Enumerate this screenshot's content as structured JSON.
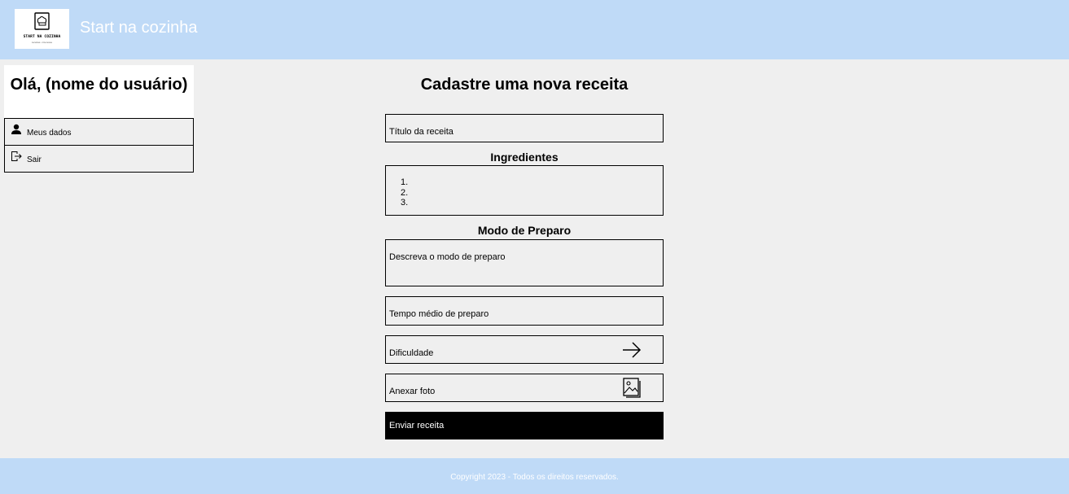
{
  "header": {
    "logo_text": "START NA COZINHA",
    "logo_subtext": "receitas • interesse",
    "app_title": "Start na cozinha"
  },
  "sidebar": {
    "greeting": "Olá, (nome do usuário)",
    "items": [
      {
        "label": "Meus dados",
        "icon": "user-icon"
      },
      {
        "label": "Sair",
        "icon": "logout-icon"
      }
    ]
  },
  "form": {
    "title": "Cadastre uma nova receita",
    "recipe_title_placeholder": "Título da receita",
    "ingredients_label": "Ingredientes",
    "ingredients_list": [
      "1.",
      "2.",
      "3."
    ],
    "method_label": "Modo de Preparo",
    "method_placeholder": "Descreva o modo de preparo",
    "time_placeholder": "Tempo médio de preparo",
    "difficulty_label": "Dificuldade",
    "difficulty_icon": "arrow-right-icon",
    "photo_label": "Anexar foto",
    "photo_icon": "image-icon",
    "submit_label": "Enviar receita"
  },
  "footer": {
    "copyright": "Copyright 2023 - Todos os direitos reservados."
  },
  "colors": {
    "header_bg": "#bfdaf7",
    "page_bg": "#efefef",
    "button_bg": "#000000"
  }
}
